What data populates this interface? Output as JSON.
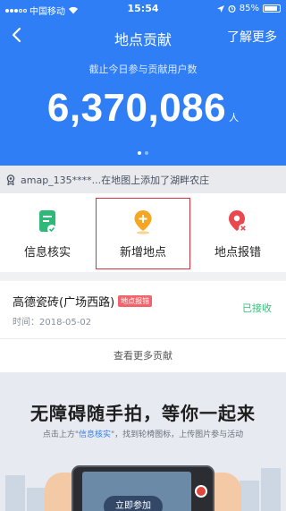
{
  "status_bar": {
    "carrier": "中国移动",
    "time": "15:54",
    "battery_text": "85%",
    "battery_level": 0.85
  },
  "nav": {
    "title": "地点贡献",
    "learn_more": "了解更多"
  },
  "stats": {
    "caption": "截止今日参与贡献用户数",
    "count": "6,370,086",
    "unit": "人"
  },
  "ticker": {
    "text": "amap_135****...在地图上添加了湖畔农庄"
  },
  "actions": [
    {
      "label": "信息核实",
      "icon": "document-check-icon",
      "color": "#2fb978"
    },
    {
      "label": "新增地点",
      "icon": "map-pin-plus-icon",
      "color": "#f5a623"
    },
    {
      "label": "地点报错",
      "icon": "map-pin-error-icon",
      "color": "#e9484e"
    }
  ],
  "record": {
    "place": "高德瓷砖(广场西路)",
    "tag": "地点报错",
    "time": "时间：2018-05-02",
    "status": "已接收"
  },
  "more_link": "查看更多贡献",
  "promo": {
    "title": "无障碍随手拍，等你一起来",
    "sub_before": "点击上方\"",
    "sub_highlight": "信息核实",
    "sub_after": "\"，找到轮椅图标，上传图片参与活动",
    "button": "立即参加"
  },
  "colors": {
    "brand_blue": "#2f7ef5",
    "success_green": "#35c07b",
    "error_red": "#e9484e",
    "highlight_border": "#d8323a"
  }
}
